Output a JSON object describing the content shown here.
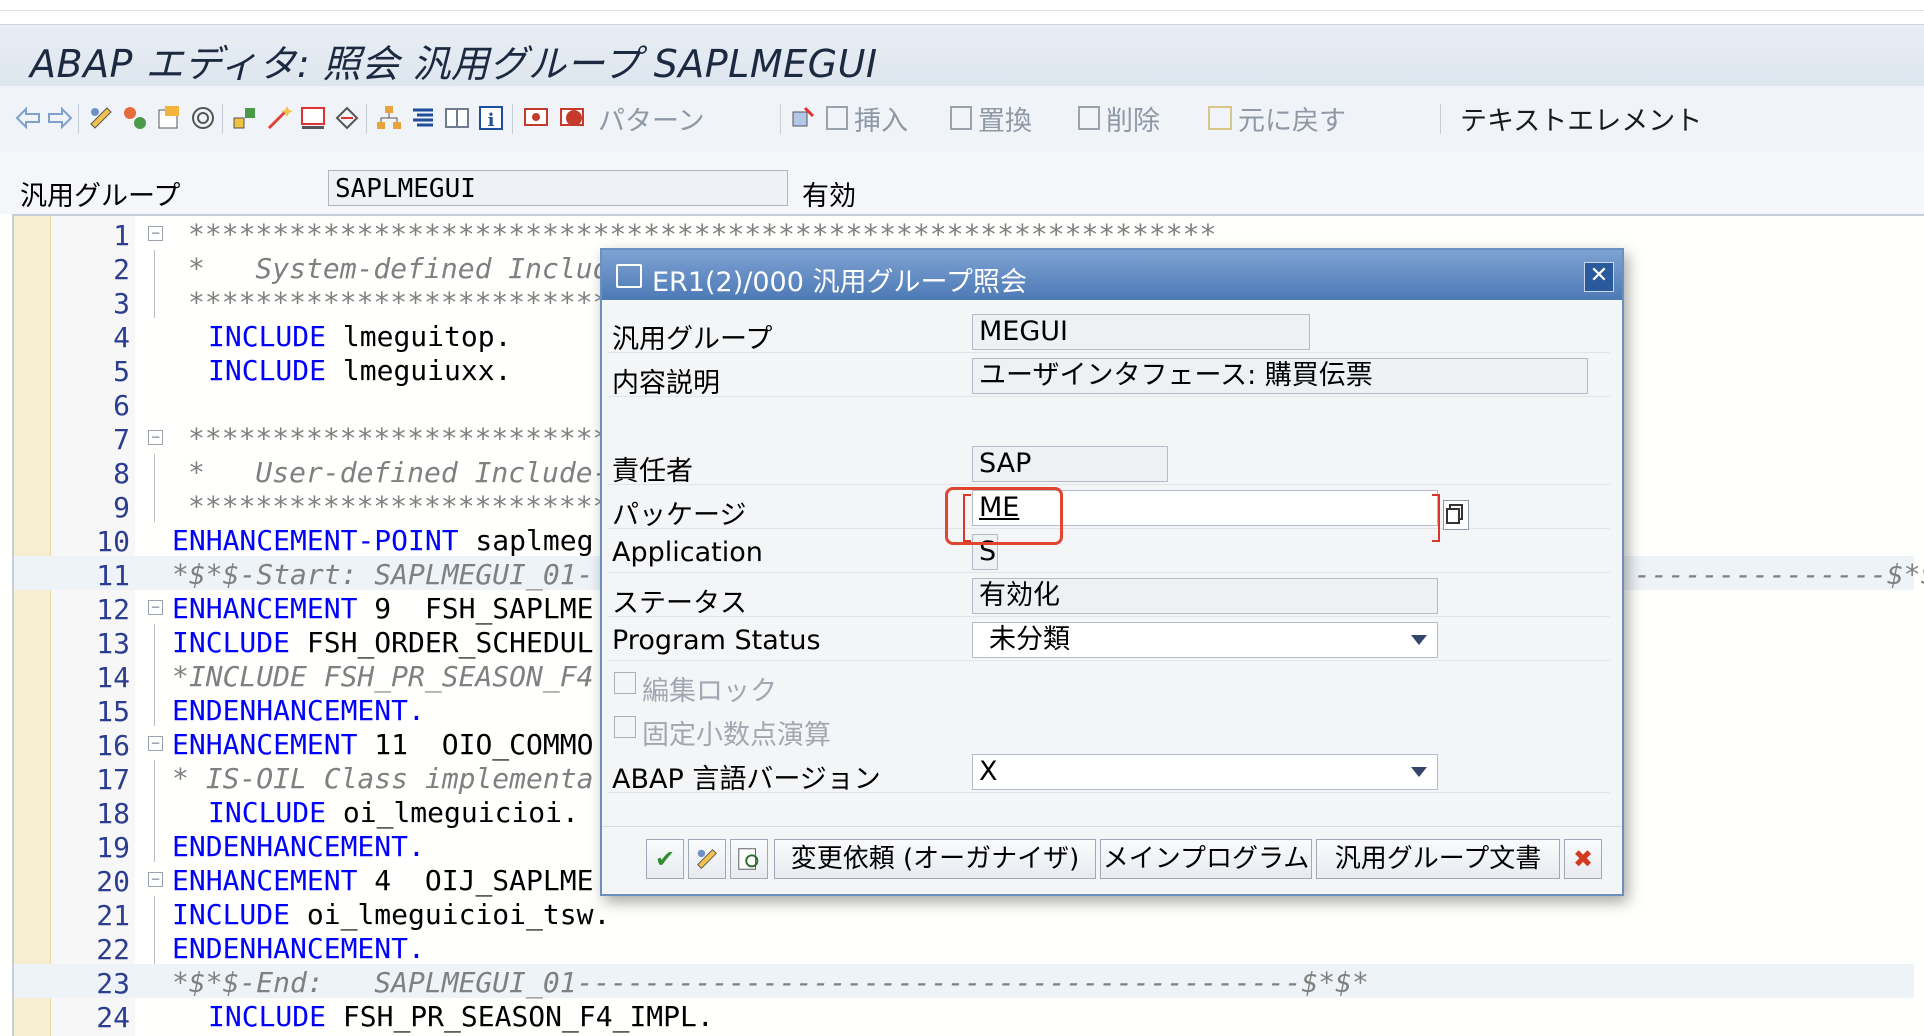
{
  "window": {
    "title": "ABAP エディタ: 照会 汎用グループ SAPLMEGUI"
  },
  "toolbar": {
    "pattern_label": "パターン",
    "insert_label": "挿入",
    "replace_label": "置換",
    "delete_label": "削除",
    "undo_label": "元に戻す",
    "text_elements_label": "テキストエレメント"
  },
  "header_field": {
    "label": "汎用グループ",
    "value": "SAPLMEGUI",
    "status": "有効"
  },
  "editor": {
    "lines": [
      {
        "n": "1"
      },
      {
        "n": "2"
      },
      {
        "n": "3"
      },
      {
        "n": "4"
      },
      {
        "n": "5"
      },
      {
        "n": "6"
      },
      {
        "n": "7"
      },
      {
        "n": "8"
      },
      {
        "n": "9"
      },
      {
        "n": "10"
      },
      {
        "n": "11"
      },
      {
        "n": "12"
      },
      {
        "n": "13"
      },
      {
        "n": "14"
      },
      {
        "n": "15"
      },
      {
        "n": "16"
      },
      {
        "n": "17"
      },
      {
        "n": "18"
      },
      {
        "n": "19"
      },
      {
        "n": "20"
      },
      {
        "n": "21"
      },
      {
        "n": "22"
      },
      {
        "n": "23"
      },
      {
        "n": "24"
      }
    ],
    "l1_comment": "*************************************************************",
    "l2_comment": "*   System-defined Includ",
    "l3_comment": "*************************************************************",
    "l4_kw": "INCLUDE",
    "l4_text": " lmeguitop.",
    "l5_kw": "INCLUDE",
    "l5_text": " lmeguiuxx.",
    "l7_comment": "*************************************************************",
    "l8_comment": "*   User-defined Include-",
    "l9_comment": "*************************************************************",
    "l10_kw": "ENHANCEMENT-POINT",
    "l10_text": " saplmeg",
    "l11_comment": "*$*$-Start: SAPLMEGUI_01-",
    "l11_tail": "---------------$*$*",
    "l12_kw": "ENHANCEMENT",
    "l12_text": " 9  FSH_SAPLME",
    "l13_kw": "INCLUDE",
    "l13_text": " FSH_ORDER_SCHEDUL",
    "l14_comment": "*INCLUDE FSH_PR_SEASON_F4",
    "l15_kw": "ENDENHANCEMENT.",
    "l16_kw": "ENHANCEMENT",
    "l16_text": " 11  OIO_COMMO",
    "l17_comment": "* IS-OIL Class implementa",
    "l18_kw": "INCLUDE",
    "l18_text": " oi_lmeguicioi.",
    "l19_kw": "ENDENHANCEMENT.",
    "l20_kw": "ENHANCEMENT",
    "l20_text": " 4  OIJ_SAPLME",
    "l21_kw": "INCLUDE",
    "l21_text": " oi_lmeguicioi_tsw.",
    "l22_kw": "ENDENHANCEMENT.",
    "l23_comment": "*$*$-End:   SAPLMEGUI_01-------------------------------------------$*$*",
    "l24_kw": "INCLUDE",
    "l24_text": " FSH_PR_SEASON_F4_IMPL."
  },
  "dialog": {
    "title": "ER1(2)/000 汎用グループ照会",
    "fields": {
      "group_label": "汎用グループ",
      "group_value": "MEGUI",
      "desc_label": "内容説明",
      "desc_value": "ユーザインタフェース: 購買伝票",
      "owner_label": "責任者",
      "owner_value": "SAP",
      "package_label": "パッケージ",
      "package_value": "ME",
      "application_label": "Application",
      "application_value": "S",
      "status_label": "ステータス",
      "status_value": "有効化",
      "program_status_label": "Program Status",
      "program_status_value": "未分類",
      "edit_lock_label": "編集ロック",
      "fixed_point_label": "固定小数点演算",
      "abap_version_label": "ABAP 言語バージョン",
      "abap_version_value": "X"
    },
    "buttons": {
      "change_request": "変更依頼 (オーガナイザ)",
      "main_program": "メインプログラム",
      "group_doc": "汎用グループ文書"
    }
  },
  "colors": {
    "keyword": "#0000ff",
    "comment": "#808080",
    "dialog_title": "#4d79b6",
    "highlight": "#e0462e"
  }
}
